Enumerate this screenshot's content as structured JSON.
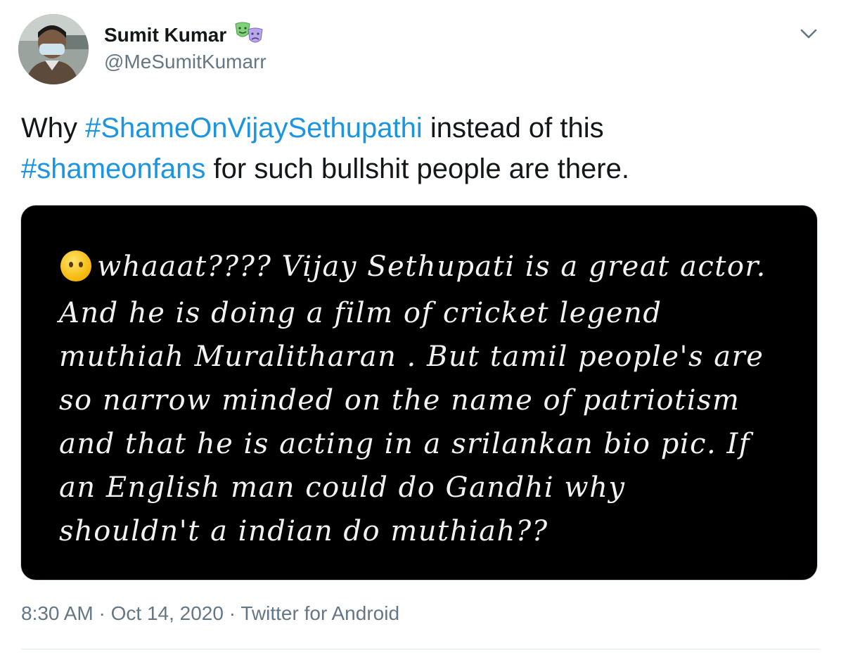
{
  "author": {
    "display_name": "Sumit Kumar",
    "handle": "@MeSumitKumarr",
    "name_emoji": "performing-arts-masks-icon"
  },
  "tweet": {
    "segments": [
      {
        "text": "Why ",
        "type": "text"
      },
      {
        "text": "#ShameOnVijaySethupathi",
        "type": "hashtag"
      },
      {
        "text": " instead of this ",
        "type": "text"
      },
      {
        "text": "#shameonfans",
        "type": "hashtag"
      },
      {
        "text": " for such bullshit people are there.",
        "type": "text"
      }
    ]
  },
  "media": {
    "lines": [
      "whaaat???? Vijay Sethupati is a great actor.",
      "And he is doing a film of cricket legend",
      "muthiah Muralitharan . But tamil people's are",
      "so narrow minded on the name of patriotism",
      "and that he is acting in a srilankan bio pic. If",
      "an English man could do Gandhi why",
      "shouldn't a indian do muthiah??"
    ],
    "leading_emoji": "face-without-mouth-icon"
  },
  "meta": {
    "time": "8:30 AM",
    "separator1": " · ",
    "date": "Oct 14, 2020",
    "separator2": " · ",
    "source": "Twitter for Android"
  },
  "colors": {
    "hashtag": "#1b95e0",
    "secondary_text": "#657786",
    "primary_text": "#14171a",
    "media_bg": "#000000"
  }
}
